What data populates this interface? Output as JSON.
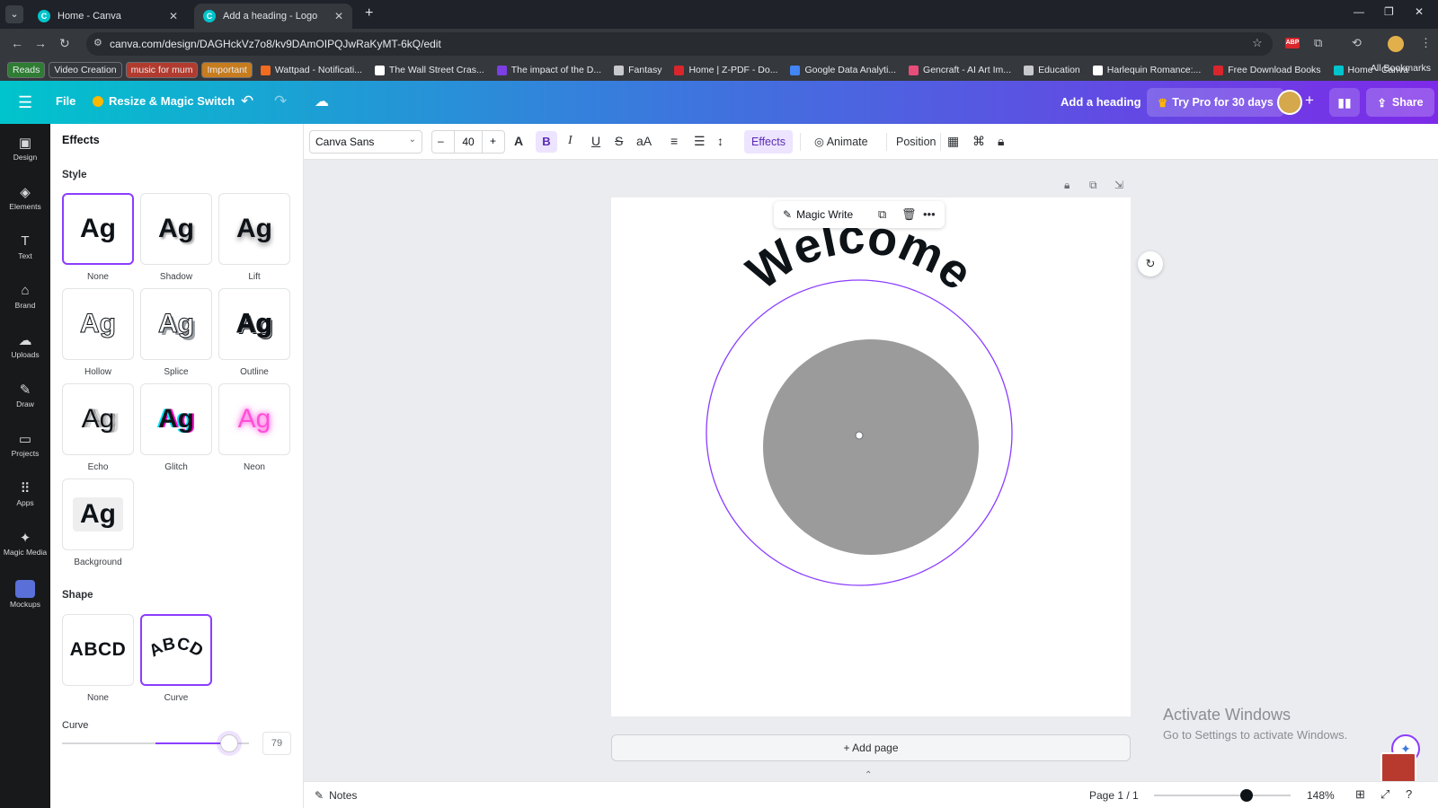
{
  "browser": {
    "tabs": [
      {
        "title": "Home - Canva",
        "favicon": "C"
      },
      {
        "title": "Add a heading - Logo",
        "favicon": "C"
      }
    ],
    "url": "canva.com/design/DAGHckVz7o8/kv9DAmOIPQJwRaKyMT-6kQ/edit",
    "bookmarks": [
      {
        "label": "Reads",
        "color": "#2e7d32",
        "pill": true
      },
      {
        "label": "Video Creation",
        "color": "#35383d",
        "pill": true
      },
      {
        "label": "music for mum",
        "color": "#b23b2f",
        "pill": true
      },
      {
        "label": "Important",
        "color": "#c77c1e",
        "pill": true
      },
      {
        "label": "Wattpad - Notificati...",
        "color": "#f26b21",
        "pill": false
      },
      {
        "label": "The Wall Street Cras...",
        "color": "#ffffff",
        "pill": false
      },
      {
        "label": "The impact of the D...",
        "color": "#7b3fe4",
        "pill": false
      },
      {
        "label": "Fantasy",
        "color": "#c7c9cc",
        "pill": false
      },
      {
        "label": "Home | Z-PDF - Do...",
        "color": "#d8262c",
        "pill": false
      },
      {
        "label": "Google Data Analyti...",
        "color": "#4285f4",
        "pill": false
      },
      {
        "label": "Gencraft - AI Art Im...",
        "color": "#e84d7a",
        "pill": false
      },
      {
        "label": "Education",
        "color": "#c7c9cc",
        "pill": false
      },
      {
        "label": "Harlequin Romance:...",
        "color": "#ffffff",
        "pill": false
      },
      {
        "label": "Free Download Books",
        "color": "#d8262c",
        "pill": false
      },
      {
        "label": "Home - Canva",
        "color": "#00c4cc",
        "pill": false
      }
    ],
    "all_bookmarks": "All Bookmarks"
  },
  "header": {
    "file": "File",
    "resize": "Resize & Magic Switch",
    "title": "Add a heading",
    "try_pro": "Try Pro for 30 days",
    "share": "Share"
  },
  "rail": [
    {
      "label": "Design",
      "icon": "▣"
    },
    {
      "label": "Elements",
      "icon": "◈"
    },
    {
      "label": "Text",
      "icon": "T"
    },
    {
      "label": "Brand",
      "icon": "⌂"
    },
    {
      "label": "Uploads",
      "icon": "☁"
    },
    {
      "label": "Draw",
      "icon": "✎"
    },
    {
      "label": "Projects",
      "icon": "▭"
    },
    {
      "label": "Apps",
      "icon": "⠿"
    },
    {
      "label": "Magic Media",
      "icon": "✦"
    },
    {
      "label": "Mockups",
      "icon": ""
    }
  ],
  "panel": {
    "title": "Effects",
    "style_label": "Style",
    "styles": [
      {
        "label": "None",
        "sample": "Ag"
      },
      {
        "label": "Shadow",
        "sample": "Ag"
      },
      {
        "label": "Lift",
        "sample": "Ag"
      },
      {
        "label": "Hollow",
        "sample": "Ag"
      },
      {
        "label": "Splice",
        "sample": "Ag"
      },
      {
        "label": "Outline",
        "sample": "Ag"
      },
      {
        "label": "Echo",
        "sample": "Ag"
      },
      {
        "label": "Glitch",
        "sample": "Ag"
      },
      {
        "label": "Neon",
        "sample": "Ag"
      },
      {
        "label": "Background",
        "sample": "Ag"
      }
    ],
    "selected_style": "None",
    "shape_label": "Shape",
    "shapes": [
      {
        "label": "None",
        "sample": "ABCD"
      },
      {
        "label": "Curve",
        "sample": "ABCD"
      }
    ],
    "selected_shape": "Curve",
    "curve_label": "Curve",
    "curve_value": "79"
  },
  "toolbar": {
    "font": "Canva Sans",
    "size": "40",
    "effects": "Effects",
    "animate": "Animate",
    "position": "Position"
  },
  "canvas": {
    "magic_write": "Magic Write",
    "heading_text": "Welcome",
    "add_page": "+ Add page",
    "circle_fill": "#9b9b9b",
    "ring_color": "#8b3dff"
  },
  "watermark": {
    "line1": "Activate Windows",
    "line2": "Go to Settings to activate Windows."
  },
  "footer": {
    "notes": "Notes",
    "page": "Page 1 / 1",
    "zoom": "148%",
    "zoom_level": 0.68
  }
}
